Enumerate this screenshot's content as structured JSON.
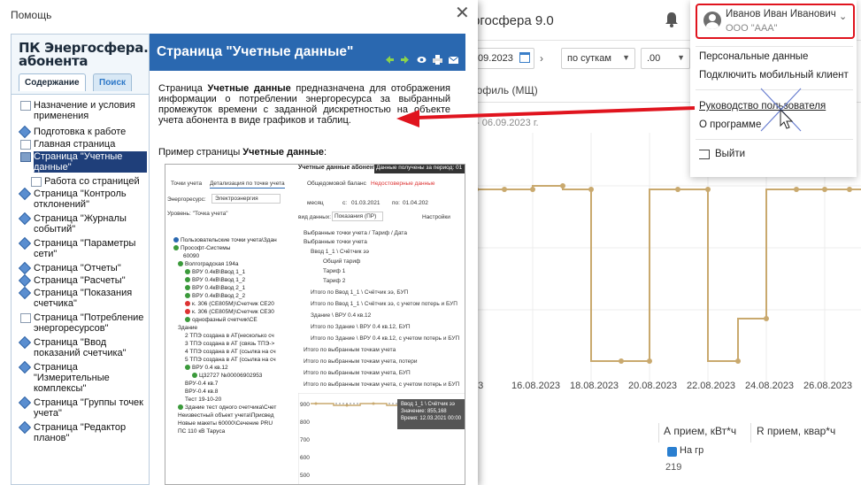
{
  "app": {
    "title": "ргосфера 9.0",
    "filters": {
      "date": ".09.2023",
      "period": "по суткам",
      "time": ".00"
    },
    "tab": "рофиль (МЩ)",
    "date_range": "- 06.09.2023 г.",
    "x_labels": [
      "23",
      "16.08.2023",
      "18.08.2023",
      "20.08.2023",
      "22.08.2023",
      "24.08.2023",
      "26.08.2023"
    ],
    "grid": {
      "col_a": "А прием, кВт*ч",
      "col_r": "R прием, квар*ч",
      "row_text": "На гр",
      "row_num": "219"
    }
  },
  "user": {
    "name": "Иванов Иван Иванович",
    "org": "ООО \"ААА\"",
    "menu": [
      "Персональные данные",
      "Подключить мобильный клиент",
      "Руководство пользователя",
      "О программе",
      "Выйти"
    ]
  },
  "help": {
    "title": "Помощь",
    "brand": "ПК Энергосфера. абонента",
    "tabs": [
      "Содержание",
      "Поиск"
    ],
    "toc": [
      {
        "label": "Назначение и условия применения",
        "icon": "doc"
      },
      {
        "label": "Подготовка к работе",
        "icon": "dia"
      },
      {
        "label": "Главная страница",
        "icon": "doc"
      },
      {
        "label": "Страница \"Учетные данные\"",
        "icon": "book",
        "selected": true
      },
      {
        "label": "Работа со страницей",
        "icon": "doc"
      },
      {
        "label": "Страница \"Контроль отклонений\"",
        "icon": "dia"
      },
      {
        "label": "Страница \"Журналы событий\"",
        "icon": "dia"
      },
      {
        "label": "Страница \"Параметры сети\"",
        "icon": "dia"
      },
      {
        "label": "Страница \"Отчеты\"",
        "icon": "dia"
      },
      {
        "label": "Страница \"Расчеты\"",
        "icon": "dia"
      },
      {
        "label": "Страница \"Показания счетчика\"",
        "icon": "dia"
      },
      {
        "label": "Страница \"Потребление энергоресурсов\"",
        "icon": "doc"
      },
      {
        "label": "Страница \"Ввод показаний счетчика\"",
        "icon": "dia"
      },
      {
        "label": "Страница \"Измерительные комплексы\"",
        "icon": "dia"
      },
      {
        "label": "Страница \"Группы точек учета\"",
        "icon": "dia"
      },
      {
        "label": "Страница \"Редактор планов\"",
        "icon": "dia"
      }
    ],
    "page_title": "Страница \"Учетные данные\"",
    "para_pre": "Страница ",
    "para_bold": "Учетные данные",
    "para_post": " предназначена для отображения информации о потреблении энергоресурса за выбранный промежуток времени с заданной дискретностью на объекте учета абонента в виде графиков и таблиц.",
    "example_pre": "Пример страницы ",
    "example_bold": "Учетные данные",
    "example_post": ":",
    "shot": {
      "header": "Учетные данные абонента",
      "header2": "Данные получены за период: 01",
      "tabs": [
        "Точки учета",
        "Детализация по точке учета"
      ],
      "resource_label": "Энергоресурс:",
      "resource_value": "Электроэнергия",
      "level_label": "Уровень: \"Точка учета\"",
      "tabs2": [
        "Общедомовой баланс",
        "Недостоверные данные"
      ],
      "month": "месяц",
      "from_label": "с:",
      "from_value": "01.03.2021",
      "to_label": "по:",
      "to_value": "01.04.202",
      "view_label": "вид данных:",
      "view_value": "Показания (ПР)",
      "settings": "Настройки",
      "col_header": "Выбранные точки учета / Тариф / Дата",
      "tree": [
        "Пользовательские точки учета\\Здан",
        "Прософт-Системы",
        "60090",
        "Волгоградская 194а",
        "ВРУ 0.4кВ\\Ввод 1_1",
        "ВРУ 0.4кВ\\Ввод 1_2",
        "ВРУ 0.4кВ\\Ввод 2_1",
        "ВРУ 0.4кВ\\Ввод 2_2",
        "к. 306 (СЕ805М)\\Счетчик СЕ20",
        "к. 306 (СЕ805М)\\Счетчик СЕ30",
        "однофазный счетчик\\СЕ",
        "Здание",
        "2 ТПЭ создана в АТ(несколько сч",
        "3 ТПЭ создана в АТ (связь ТПЭ->",
        "4 ТПЭ создана в АТ (ссылка на сч",
        "5 ТПЭ создана в АТ (ссылка на сч",
        "ВРУ 0.4 кв.12",
        "Ц32727 №00006902953",
        "ВРУ-0.4 кв.7",
        "ВРУ-0.4 кв.8",
        "Тест 19-10-20",
        "Здание тест одного счетчика\\Счет",
        "Неизвестный объект учета\\Присвед",
        "Новые макеты 60000\\Сечение PRU",
        "ПС 110 кВ Тарусa"
      ],
      "rows": [
        "Выбранные точки учета",
        "Ввод 1_1 \\ Счётчик ээ",
        "Общий тариф",
        "Тариф 1",
        "Тариф 2",
        "Итого по Ввод 1_1 \\ Счётчик ээ, БУП",
        "Итого по Ввод 1_1 \\ Счётчик ээ, с учетом потерь и БУП",
        "Здание \\ ВРУ 0.4 кв.12",
        "Итого по Здание \\ ВРУ 0.4 кв.12, БУП",
        "Итого по Здание \\ ВРУ 0.4 кв.12, с учетом потерь и БУП",
        "Итого по выбранным точкам учета",
        "Итого по выбранным точкам учета, потери",
        "Итого по выбранным точкам учета, БУП",
        "Итого по выбранным точкам учета, с учетом потерь и БУП"
      ],
      "y_ticks": [
        "900",
        "800",
        "700",
        "600",
        "500"
      ],
      "tooltip": [
        "Ввод 1_1 \\ Счётчик ээ",
        "Значение: 855,168",
        "Время: 12.03.2021 00:00"
      ]
    }
  },
  "colors": {
    "help_header": "#2a68b0",
    "arrow": "#e0141e",
    "chart_line": "#c9a96e"
  }
}
